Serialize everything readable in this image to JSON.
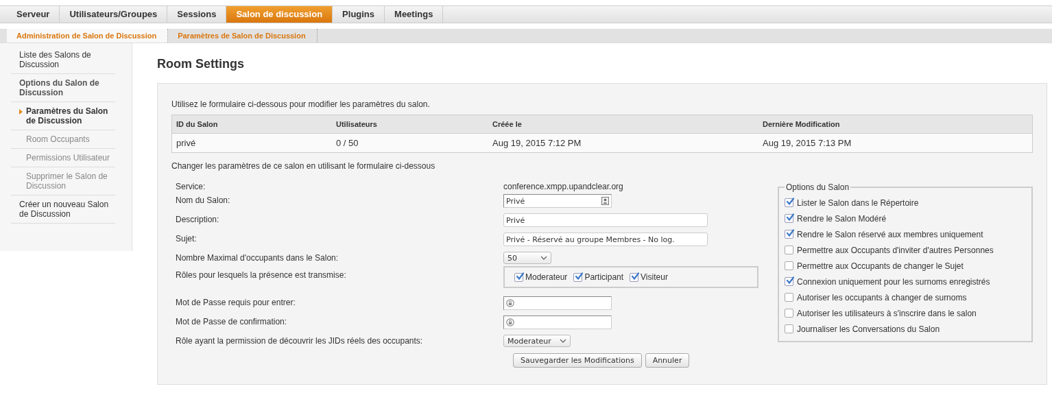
{
  "top_tabs": [
    {
      "label": "Serveur",
      "selected": false
    },
    {
      "label": "Utilisateurs/Groupes",
      "selected": false
    },
    {
      "label": "Sessions",
      "selected": false
    },
    {
      "label": "Salon de discussion",
      "selected": true
    },
    {
      "label": "Plugins",
      "selected": false
    },
    {
      "label": "Meetings",
      "selected": false
    }
  ],
  "sub_tabs": [
    {
      "label": "Administration de Salon de Discussion",
      "selected": true
    },
    {
      "label": "Paramètres de Salon de Discussion",
      "selected": false
    }
  ],
  "sidebar": {
    "items": [
      {
        "label": "Liste des Salons de Discussion",
        "selected": false
      },
      {
        "label": "Options du Salon de Discussion",
        "selected": false,
        "children": [
          {
            "label": "Paramètres du Salon de Discussion",
            "selected": true
          },
          {
            "label": "Room Occupants",
            "selected": false
          },
          {
            "label": "Permissions Utilisateur",
            "selected": false
          },
          {
            "label": "Supprimer le Salon de Discussion",
            "selected": false
          }
        ]
      },
      {
        "label": "Créer un nouveau Salon de Discussion",
        "selected": false
      }
    ]
  },
  "page_title": "Room Settings",
  "intro": "Utilisez le formulaire ci-dessous pour modifier les paramètres du salon.",
  "table": {
    "columns": [
      "ID du Salon",
      "Utilisateurs",
      "Créée le",
      "Dernière Modification"
    ],
    "rows": [
      [
        "privé",
        "0 / 50",
        "Aug 19, 2015 7:12 PM",
        "Aug 19, 2015 7:13 PM"
      ]
    ]
  },
  "form_intro": "Changer les paramètres de ce salon en utilisant le formulaire ci-dessous",
  "form": {
    "fields": [
      {
        "kind": "static",
        "label": "Service:",
        "value": "conference.xmpp.upandclear.org"
      },
      {
        "kind": "short",
        "label": "Nom du Salon:",
        "value": "Privé"
      },
      {
        "kind": "text",
        "label": "Description:",
        "value": "Privé"
      },
      {
        "kind": "text",
        "label": "Sujet:",
        "value": "Privé - Réservé au groupe Membres - No log."
      },
      {
        "kind": "select",
        "label": "Nombre Maximal d'occupants dans le Salon:",
        "value": "50"
      },
      {
        "kind": "checkboxes",
        "label": "Rôles pour lesquels la présence est transmise:",
        "options": [
          {
            "label": "Moderateur",
            "checked": true
          },
          {
            "label": "Participant",
            "checked": true
          },
          {
            "label": "Visiteur",
            "checked": true
          }
        ]
      },
      {
        "kind": "password",
        "label": "Mot de Passe requis pour entrer:"
      },
      {
        "kind": "password",
        "label": "Mot de Passe de confirmation:"
      },
      {
        "kind": "select",
        "label": "Rôle ayant la permission de découvrir les JIDs réels des occupants:",
        "value": "Moderateur"
      }
    ],
    "buttons": [
      "Sauvegarder les Modifications",
      "Annuler"
    ]
  },
  "options": {
    "legend": "Options du Salon",
    "items": [
      {
        "label": "Lister le Salon dans le Répertoire",
        "checked": true
      },
      {
        "label": "Rendre le Salon Modéré",
        "checked": true
      },
      {
        "label": "Rendre le Salon réservé aux membres uniquement",
        "checked": true
      },
      {
        "label": "Permettre aux Occupants d'inviter d'autres Personnes",
        "checked": false
      },
      {
        "label": "Permettre aux Occupants de changer le Sujet",
        "checked": false
      },
      {
        "label": "Connexion uniquement pour les surnoms enregistrés",
        "checked": true
      },
      {
        "label": "Autoriser les occupants à changer de surnoms",
        "checked": false
      },
      {
        "label": "Autoriser les utilisateurs à s'inscrire dans le salon",
        "checked": false
      },
      {
        "label": "Journaliser les Conversations du Salon",
        "checked": false
      }
    ]
  }
}
